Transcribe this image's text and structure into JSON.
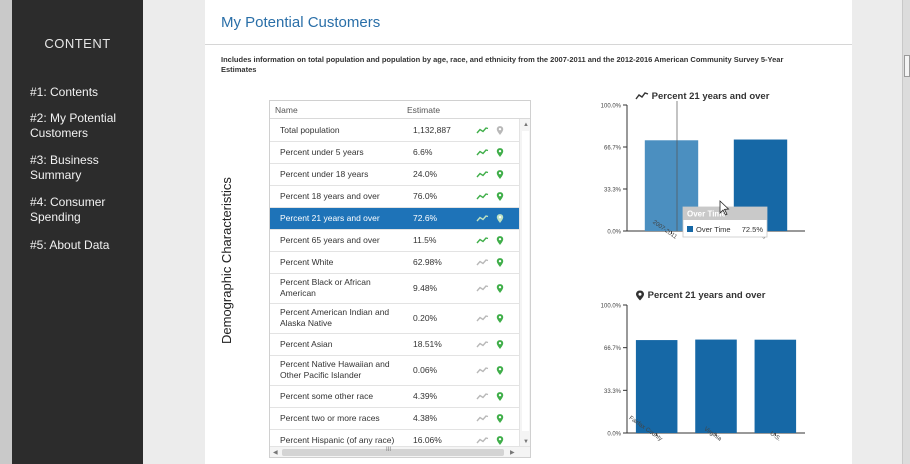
{
  "sidebar": {
    "title": "CONTENT",
    "items": [
      {
        "label": "#1: Contents"
      },
      {
        "label": "#2: My Potential Customers"
      },
      {
        "label": "#3: Business Summary"
      },
      {
        "label": "#4: Consumer Spending"
      },
      {
        "label": "#5: About Data"
      }
    ]
  },
  "main": {
    "title": "My Potential Customers",
    "description": "Includes information on total population and population by age, race, and ethnicity from the 2007-2011 and the 2012-2016 American Community Survey 5-Year Estimates",
    "section_label": "Demographic Characteristics"
  },
  "table": {
    "columns": {
      "name": "Name",
      "estimate": "Estimate"
    },
    "selected_index": 4,
    "rows": [
      {
        "name": "Total population",
        "estimate": "1,132,887",
        "trend_active": true,
        "pin_active": false
      },
      {
        "name": "Percent under 5 years",
        "estimate": "6.6%",
        "trend_active": true,
        "pin_active": true
      },
      {
        "name": "Percent under 18 years",
        "estimate": "24.0%",
        "trend_active": true,
        "pin_active": true
      },
      {
        "name": "Percent 18 years and over",
        "estimate": "76.0%",
        "trend_active": true,
        "pin_active": true
      },
      {
        "name": "Percent 21 years and over",
        "estimate": "72.6%",
        "trend_active": true,
        "pin_active": true
      },
      {
        "name": "Percent 65 years and over",
        "estimate": "11.5%",
        "trend_active": true,
        "pin_active": true
      },
      {
        "name": "Percent White",
        "estimate": "62.98%",
        "trend_active": false,
        "pin_active": true
      },
      {
        "name": "Percent Black or African American",
        "estimate": "9.48%",
        "trend_active": false,
        "pin_active": true
      },
      {
        "name": "Percent American Indian and Alaska Native",
        "estimate": "0.20%",
        "trend_active": false,
        "pin_active": true
      },
      {
        "name": "Percent Asian",
        "estimate": "18.51%",
        "trend_active": false,
        "pin_active": true
      },
      {
        "name": "Percent Native Hawaiian and Other Pacific Islander",
        "estimate": "0.06%",
        "trend_active": false,
        "pin_active": true
      },
      {
        "name": "Percent some other race",
        "estimate": "4.39%",
        "trend_active": false,
        "pin_active": true
      },
      {
        "name": "Percent two or more races",
        "estimate": "4.38%",
        "trend_active": false,
        "pin_active": true
      },
      {
        "name": "Percent Hispanic (of any race)",
        "estimate": "16.06%",
        "trend_active": false,
        "pin_active": true
      }
    ],
    "hscroll_label": "III"
  },
  "chart_data": [
    {
      "type": "bar",
      "title": "Percent 21 years and over",
      "title_icon": "trend-line-icon",
      "categories": [
        "2007-2011",
        "2012-2016"
      ],
      "series": [
        {
          "values": [
            72.0,
            72.6
          ]
        }
      ],
      "ylim": [
        0,
        100
      ],
      "yticks": [
        "0.0%",
        "33.3%",
        "66.7%",
        "100.0%"
      ],
      "tooltip": {
        "title": "Over Time",
        "series": "Over Time",
        "value": "72.5%"
      }
    },
    {
      "type": "bar",
      "title": "Percent 21 years and over",
      "title_icon": "map-pin-icon",
      "categories": [
        "Fairfax County",
        "Virginia",
        "U.S."
      ],
      "series": [
        {
          "values": [
            72.6,
            73.0,
            72.9
          ]
        }
      ],
      "ylim": [
        0,
        100
      ],
      "yticks": [
        "0.0%",
        "33.3%",
        "66.7%",
        "100.0%"
      ]
    }
  ],
  "colors": {
    "sidebar_bg": "#2c2c2c",
    "accent": "#1e73b8",
    "bar": "#1668a6",
    "bar_highlight": "#4b8fc0",
    "title_blue": "#2a6fa8",
    "trend_green": "#3fae49",
    "trend_inactive": "#b8b8b8"
  }
}
